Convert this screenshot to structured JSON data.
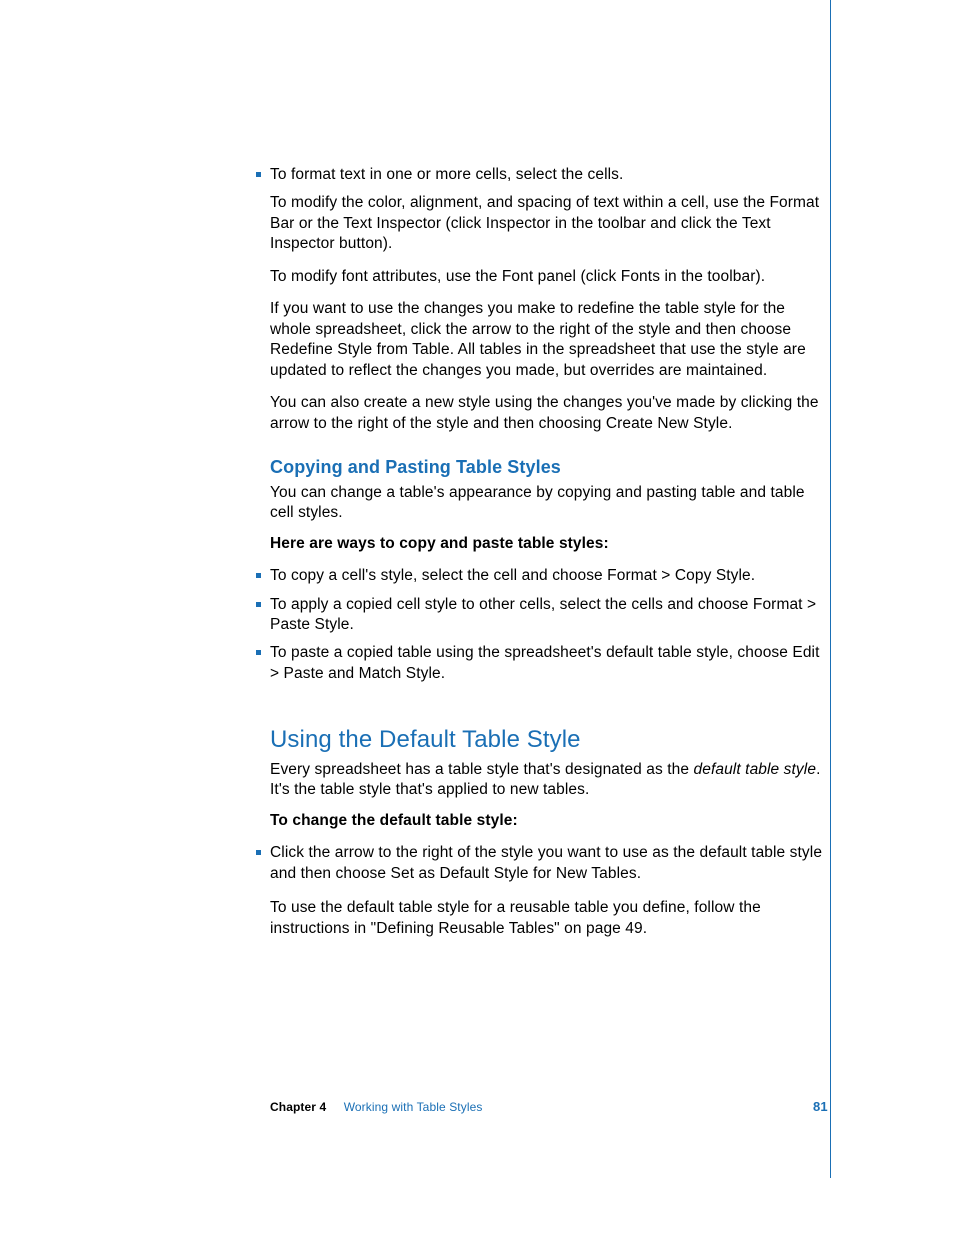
{
  "sec1": {
    "b1": "To format text in one or more cells, select the cells.",
    "p1": "To modify the color, alignment, and spacing of text within a cell, use the Format Bar or the Text Inspector (click Inspector in the toolbar and click the Text Inspector button).",
    "p2": "To modify font attributes, use the Font panel (click Fonts in the toolbar).",
    "p3": "If you want to use the changes you make to redefine the table style for the whole spreadsheet, click the arrow to the right of the style and then choose Redefine Style from Table. All tables in the spreadsheet that use the style are updated to reflect the changes you made, but overrides are maintained.",
    "p4": "You can also create a new style using the changes you've made by clicking the arrow to the right of the style and then choosing Create New Style."
  },
  "sec2": {
    "heading": "Copying and Pasting Table Styles",
    "intro": "You can change a table's appearance by copying and pasting table and table cell styles.",
    "lead": "Here are ways to copy and paste table styles:",
    "b1": "To copy a cell's style, select the cell and choose Format > Copy Style.",
    "b2": "To apply a copied cell style to other cells, select the cells and choose Format > Paste Style.",
    "b3": "To paste a copied table using the spreadsheet's default table style, choose Edit > Paste and Match Style."
  },
  "sec3": {
    "heading": "Using the Default Table Style",
    "intro_a": "Every spreadsheet has a table style that's designated as the ",
    "intro_em": "default table style",
    "intro_b": ". It's the table style that's applied to new tables.",
    "lead": "To change the default table style:",
    "b1": "Click the arrow to the right of the style you want to use as the default table style and then choose Set as Default Style for New Tables.",
    "p1": "To use the default table style for a reusable table you define, follow the instructions in \"Defining Reusable Tables\" on page 49."
  },
  "footer": {
    "chapter": "Chapter 4",
    "title": "Working with Table Styles",
    "page": "81"
  }
}
